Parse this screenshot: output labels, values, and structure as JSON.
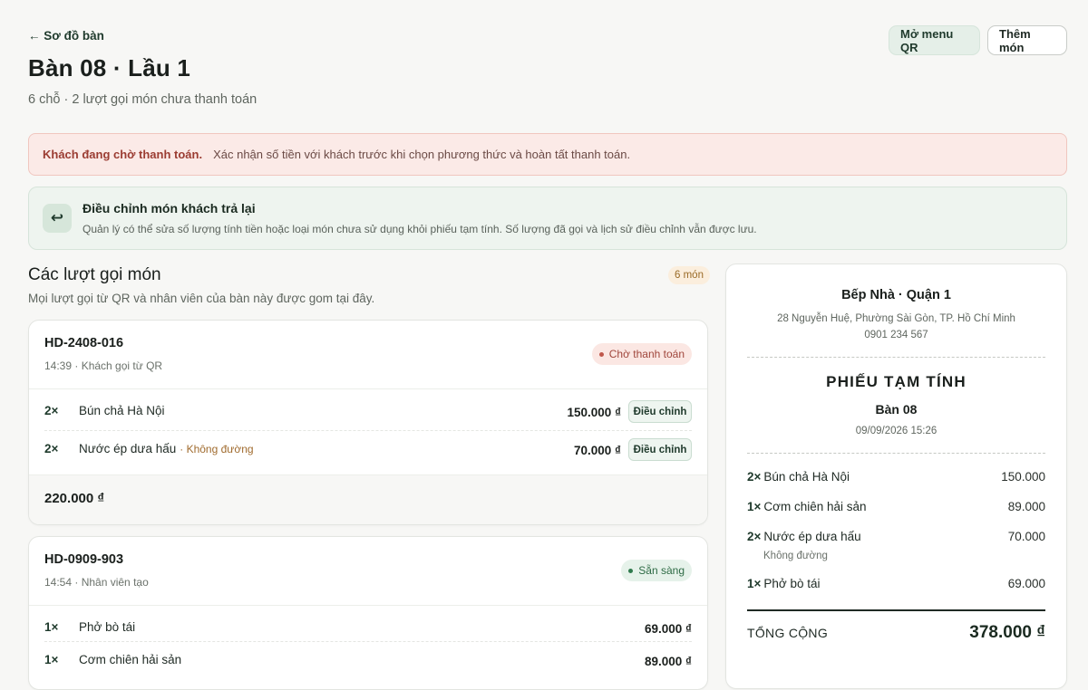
{
  "header": {
    "back_label": "← Sơ đồ bàn",
    "title": "Bàn 08 · Lầu 1",
    "subtitle": "6 chỗ · 2 lượt gọi món chưa thanh toán",
    "open_qr_label": "Mở menu QR",
    "add_item_label": "Thêm món"
  },
  "alert": {
    "strong": "Khách đang chờ thanh toán.",
    "text": "Xác nhận số tiền với khách trước khi chọn phương thức và hoàn tất thanh toán."
  },
  "adjust_panel": {
    "icon": "return-arrow-icon",
    "title": "Điều chỉnh món khách trả lại",
    "description": "Quản lý có thể sửa số lượng tính tiền hoặc loại món chưa sử dụng khỏi phiếu tạm tính. Số lượng đã gọi và lịch sử điều chỉnh vẫn được lưu."
  },
  "orders_section": {
    "title": "Các lượt gọi món",
    "subtitle": "Mọi lượt gọi từ QR và nhân viên của bàn này được gom tại đây.",
    "count_badge": "6 món"
  },
  "orders": [
    {
      "code": "HD-2408-016",
      "meta": "14:39 · Khách gọi từ QR",
      "status": "Chờ thanh toán",
      "items": [
        {
          "qty": "2×",
          "name": "Bún chả Hà Nội",
          "note": "",
          "price": "150.000 ₫",
          "action": "Điều chỉnh"
        },
        {
          "qty": "2×",
          "name": "Nước ép dưa hấu",
          "note": "· Không đường",
          "price": "70.000 ₫",
          "action": "Điều chỉnh"
        }
      ],
      "total": "220.000 ₫"
    },
    {
      "code": "HD-0909-903",
      "meta": "14:54 · Nhân viên tạo",
      "status": "Sẵn sàng",
      "items": [
        {
          "qty": "1×",
          "name": "Phở bò tái",
          "price": "69.000 ₫"
        },
        {
          "qty": "1×",
          "name": "Cơm chiên hải sản",
          "price": "89.000 ₫"
        }
      ]
    }
  ],
  "receipt": {
    "shop": "Bếp Nhà · Quận 1",
    "address": "28 Nguyễn Huệ, Phường Sài Gòn, TP. Hồ Chí Minh",
    "phone": "0901 234 567",
    "title": "PHIẾU TẠM TÍNH",
    "table": "Bàn 08",
    "datetime": "09/09/2026 15:26",
    "items": [
      {
        "qty": "2×",
        "name": "Bún chả Hà Nội",
        "value": "150.000",
        "note": ""
      },
      {
        "qty": "1×",
        "name": "Cơm chiên hải sản",
        "value": "89.000",
        "note": ""
      },
      {
        "qty": "2×",
        "name": "Nước ép dưa hấu",
        "value": "70.000",
        "note": "Không đường"
      },
      {
        "qty": "1×",
        "name": "Phở bò tái",
        "value": "69.000",
        "note": ""
      }
    ],
    "total_label": "TỔNG CỘNG",
    "total_value": "378.000 ₫"
  }
}
